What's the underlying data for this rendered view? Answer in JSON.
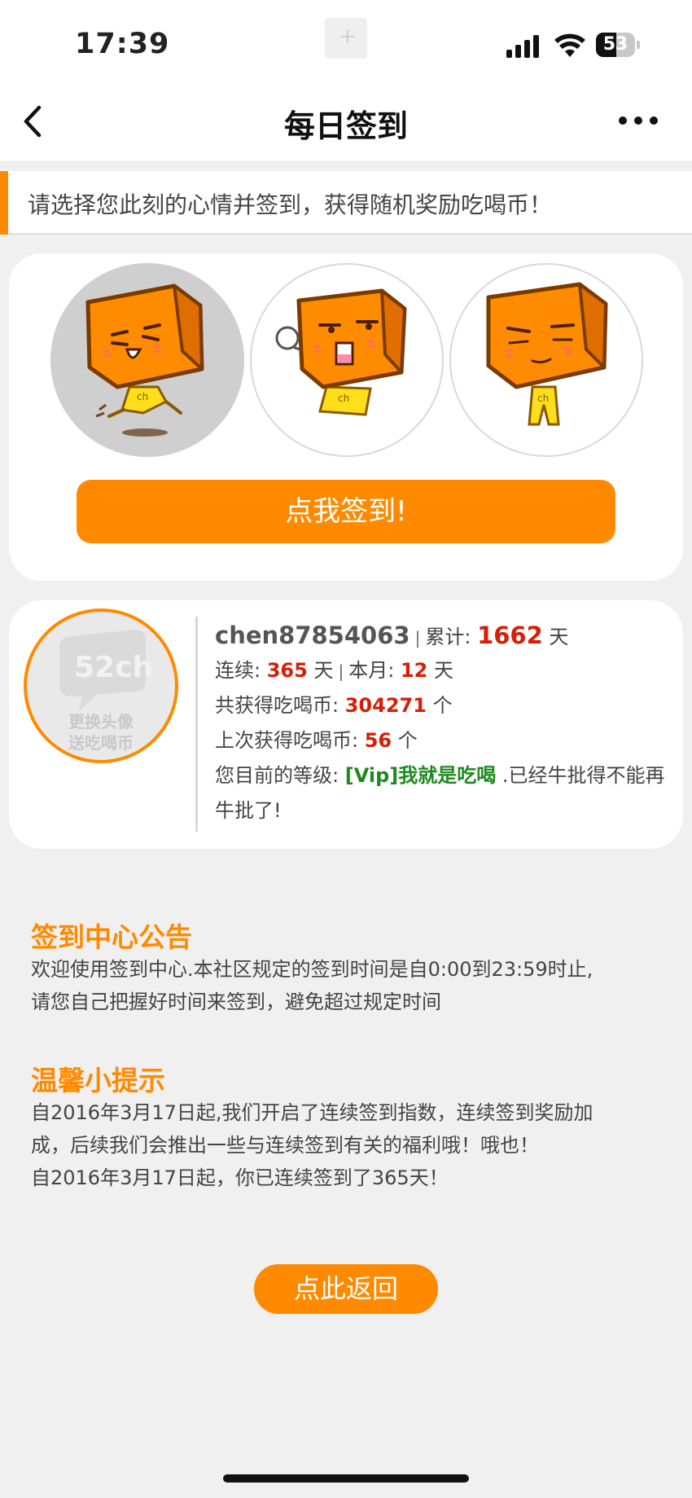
{
  "status_bar": {
    "time": "17:39",
    "battery": "53",
    "battery_level": 0.53
  },
  "nav": {
    "title": "每日签到",
    "back_icon": "chevron-left-icon",
    "more_icon": "more-dots-icon"
  },
  "banner": {
    "text": "请选择您此刻的心情并签到，获得随机奖励吃喝币！"
  },
  "moods": [
    {
      "name": "mood-happy",
      "selected": true
    },
    {
      "name": "mood-sigh",
      "selected": false
    },
    {
      "name": "mood-calm",
      "selected": false
    }
  ],
  "signin_button": "点我签到!",
  "user": {
    "avatar_brand": "52ch",
    "avatar_label_line1": "更换头像",
    "avatar_label_line2": "送吃喝币",
    "username": "chen87854063",
    "total_label": "累计:",
    "total_value": "1662",
    "day_unit": "天",
    "streak_label": "连续:",
    "streak_value": "365",
    "month_label": "本月:",
    "month_value": "12",
    "coins_label": "共获得吃喝币:",
    "coins_value": "304271",
    "count_unit": "个",
    "last_label": "上次获得吃喝币:",
    "last_value": "56",
    "level_label": "您目前的等级:",
    "level_value": "[Vip]我就是吃喝",
    "level_suffix": ".已经牛批得不能再牛批了!"
  },
  "notice": {
    "title": "签到中心公告",
    "line1": "欢迎使用签到中心.本社区规定的签到时间是自0:00到23:59时止,",
    "line2": "请您自己把握好时间来签到，避免超过规定时间"
  },
  "tips": {
    "title": "温馨小提示",
    "line1": "自2016年3月17日起,我们开启了连续签到指数，连续签到奖励加",
    "line2": "成，后续我们会推出一些与连续签到有关的福利哦！哦也！",
    "line3": "自2016年3月17日起，你已连续签到了365天！"
  },
  "return_button": "点此返回",
  "colors": {
    "accent": "#ff8a00",
    "highlight_red": "#d81e06",
    "level_green": "#1e8a1e",
    "background": "#f0f0f0"
  }
}
